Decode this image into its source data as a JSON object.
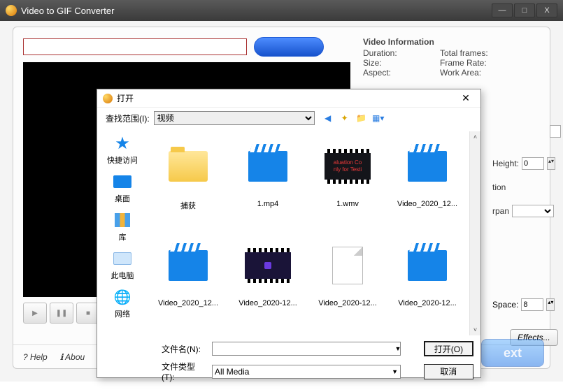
{
  "window": {
    "title": "Video to GIF Converter",
    "min": "—",
    "max": "□",
    "close": "X"
  },
  "path_placeholder": "",
  "open_video_label": "",
  "video_info": {
    "header": "Video Information",
    "duration_l": "Duration:",
    "totalframes_l": "Total frames:",
    "size_l": "Size:",
    "framerate_l": "Frame Rate:",
    "aspect_l": "Aspect:",
    "workarea_l": "Work Area:"
  },
  "right": {
    "height_l": "Height:",
    "height_v": "0",
    "tion_l": "tion",
    "rpan_l": "rpan",
    "space_l": "Space:",
    "space_v": "8"
  },
  "effects_label": "Effects...",
  "bottom": {
    "help": "? Help",
    "about": "ℹ Abou",
    "next": "ext"
  },
  "dialog": {
    "title": "打开",
    "close": "✕",
    "look_in_label": "查找范围(I):",
    "look_in_value": "视频",
    "places": {
      "quick": "快捷访问",
      "desktop": "桌面",
      "library": "库",
      "thispc": "此电脑",
      "network": "网络"
    },
    "files": [
      {
        "name": "捕获",
        "type": "folder"
      },
      {
        "name": "1.mp4",
        "type": "video"
      },
      {
        "name": "1.wmv",
        "type": "wmv",
        "overlay1": "aluation Co",
        "overlay2": "nly for Testi"
      },
      {
        "name": "Video_2020_12...",
        "type": "video"
      },
      {
        "name": "Video_2020_12...",
        "type": "video"
      },
      {
        "name": "Video_2020-12...",
        "type": "dark"
      },
      {
        "name": "Video_2020-12...",
        "type": "page"
      },
      {
        "name": "Video_2020-12...",
        "type": "video"
      }
    ],
    "filename_label": "文件名(N):",
    "filetype_label": "文件类型(T):",
    "filename_value": "",
    "filetype_value": "All Media",
    "open_btn": "打开(O)",
    "cancel_btn": "取消"
  }
}
